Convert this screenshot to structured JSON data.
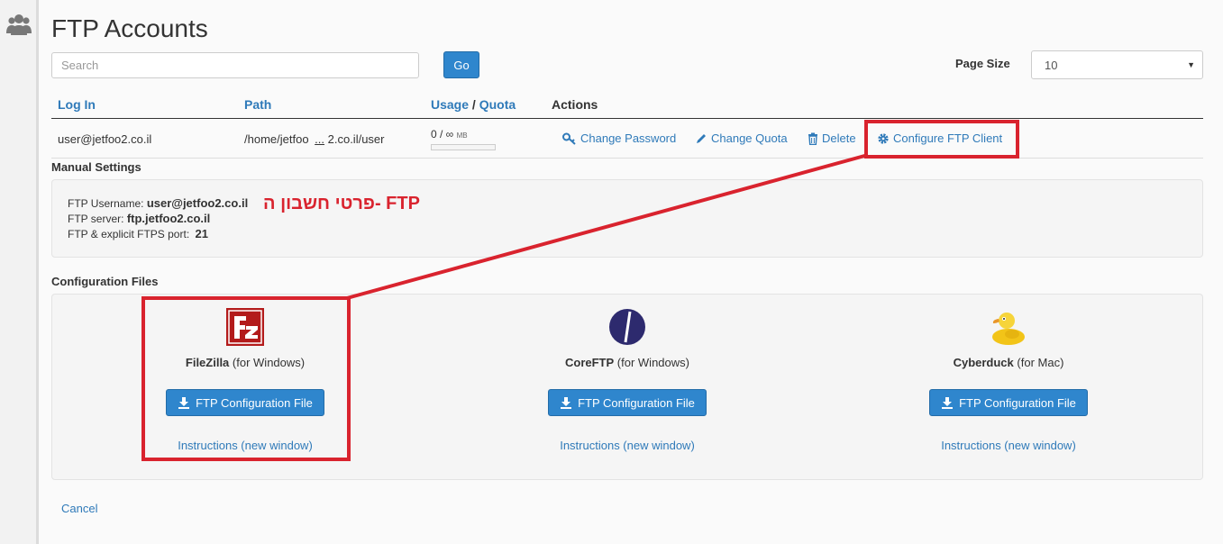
{
  "nav": {
    "icon": "users-icon"
  },
  "page": {
    "title": "FTP Accounts"
  },
  "search": {
    "placeholder": "Search",
    "value": ""
  },
  "go_label": "Go",
  "page_size": {
    "label": "Page Size",
    "value": "10"
  },
  "table": {
    "headers": {
      "login": "Log In",
      "path": "Path",
      "usage": "Usage",
      "usage_sep": "/",
      "quota": "Quota",
      "actions": "Actions"
    },
    "row": {
      "login": "user@jetfoo2.co.il",
      "path_start": "/home/jetfoo",
      "path_ellipsis": "...",
      "path_end": " 2.co.il/user",
      "usage": "0 / ∞",
      "usage_unit": "MB",
      "usage_fraction": 0,
      "actions": {
        "change_password": "Change Password",
        "change_quota": "Change Quota",
        "delete": "Delete",
        "configure": "Configure FTP Client"
      }
    }
  },
  "manual_settings": {
    "title": "Manual Settings",
    "username_label": "FTP Username:",
    "username_value": "user@jetfoo2.co.il",
    "server_label": "FTP server:",
    "server_value": "ftp.jetfoo2.co.il",
    "port_label": "FTP & explicit FTPS port:",
    "port_value": "21"
  },
  "annotation": {
    "text": "פרטי חשבון ה- FTP",
    "color": "#d9232e"
  },
  "config_files": {
    "title": "Configuration Files",
    "clients": [
      {
        "name": "FileZilla",
        "platform": "(for Windows)",
        "button": "FTP Configuration File",
        "instructions": "Instructions (new window)",
        "icon": "filezilla-logo-icon"
      },
      {
        "name": "CoreFTP",
        "platform": "(for Windows)",
        "button": "FTP Configuration File",
        "instructions": "Instructions (new window)",
        "icon": "coreftp-logo-icon"
      },
      {
        "name": "Cyberduck",
        "platform": "(for Mac)",
        "button": "FTP Configuration File",
        "instructions": "Instructions (new window)",
        "icon": "cyberduck-logo-icon"
      }
    ]
  },
  "cancel_label": "Cancel",
  "colors": {
    "accent": "#2f86cd",
    "link": "#2f7ab9",
    "highlight": "#d9232e"
  }
}
